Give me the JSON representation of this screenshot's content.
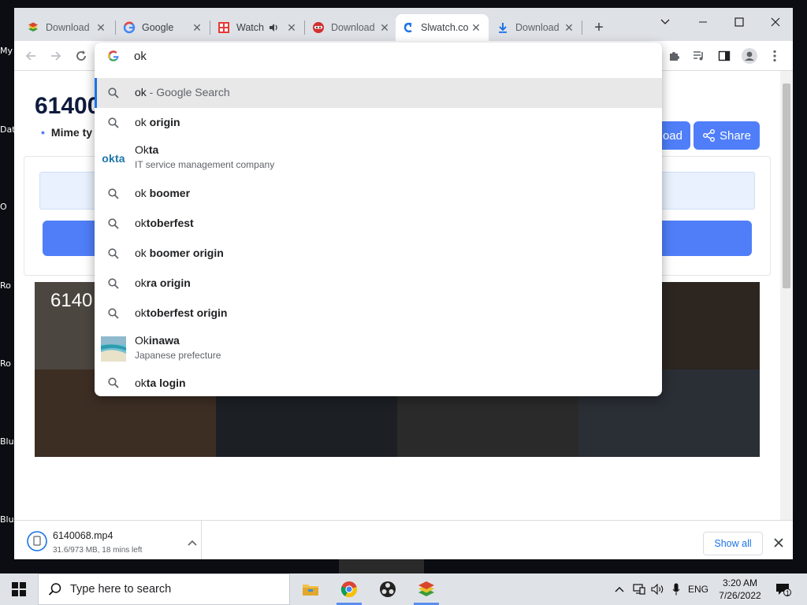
{
  "desktop": {
    "labels": [
      "My",
      "Dat",
      "O",
      "Ro",
      "Ro",
      "Blu",
      "Blu"
    ]
  },
  "tabs": [
    {
      "title": "Download",
      "icon": "bluestacks-icon"
    },
    {
      "title": "Google",
      "icon": "google-icon"
    },
    {
      "title": "Watch",
      "icon": "watch-site-icon",
      "audio": true
    },
    {
      "title": "Download",
      "icon": "ninja-icon"
    },
    {
      "title": "Slwatch.co",
      "icon": "slwatch-icon",
      "active": true
    },
    {
      "title": "Download",
      "icon": "download-icon"
    }
  ],
  "omnibox": {
    "query": "ok",
    "suggestions": [
      {
        "typed": "ok",
        "rest": " - Google Search",
        "kind": "search",
        "selected": true
      },
      {
        "typed": "ok",
        "rest": " origin",
        "kind": "search"
      },
      {
        "typed": "Ok",
        "rest": "ta",
        "kind": "entity",
        "icon": "okta-logo",
        "subtitle": "IT service management company"
      },
      {
        "typed": "ok",
        "rest": " boomer",
        "kind": "search"
      },
      {
        "typed": "ok",
        "rest": "toberfest",
        "kind": "search"
      },
      {
        "typed": "ok",
        "rest": " boomer origin",
        "kind": "search"
      },
      {
        "typed": "ok",
        "rest": "ra origin",
        "kind": "search"
      },
      {
        "typed": "ok",
        "rest": "toberfest origin",
        "kind": "search"
      },
      {
        "typed": "Ok",
        "rest": "inawa",
        "kind": "entity",
        "icon": "okinawa-thumbnail",
        "subtitle": "Japanese prefecture"
      },
      {
        "typed": "ok",
        "rest": "ta login",
        "kind": "search"
      }
    ],
    "okta_logo_text": "okta"
  },
  "page": {
    "title": "61400",
    "mime": "Mime ty",
    "download_btn": "oad",
    "share_btn": "Share",
    "video_title": "6140"
  },
  "download_bar": {
    "filename": "6140068.mp4",
    "status": "31.6/973 MB, 18 mins left",
    "show_all": "Show all"
  },
  "taskbar": {
    "search_placeholder": "Type here to search",
    "language": "ENG",
    "time": "3:20 AM",
    "date": "7/26/2022",
    "notification_count": "1"
  }
}
